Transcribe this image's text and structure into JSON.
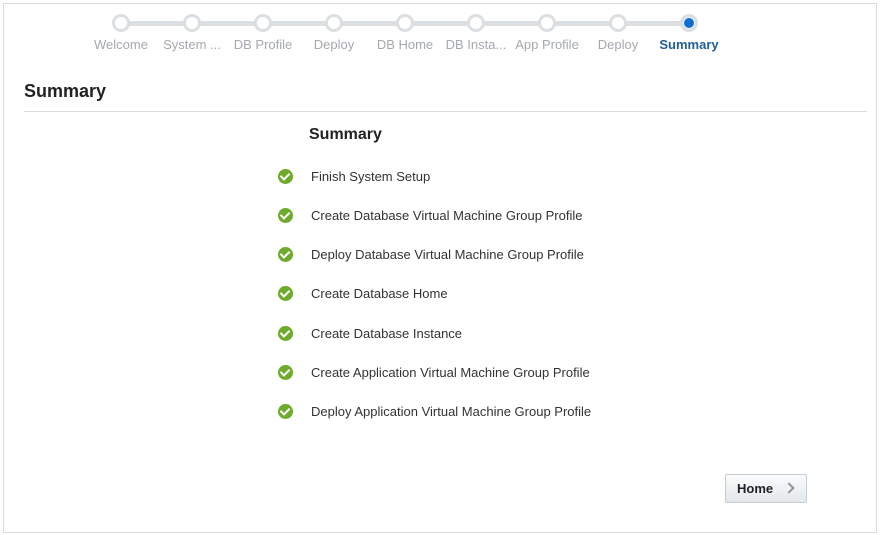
{
  "train": {
    "stops": [
      {
        "label": "Welcome",
        "current": false
      },
      {
        "label": "System ...",
        "current": false
      },
      {
        "label": "DB Profile",
        "current": false
      },
      {
        "label": "Deploy",
        "current": false
      },
      {
        "label": "DB Home",
        "current": false
      },
      {
        "label": "DB Insta...",
        "current": false
      },
      {
        "label": "App Profile",
        "current": false
      },
      {
        "label": "Deploy",
        "current": false
      },
      {
        "label": "Summary",
        "current": true
      }
    ]
  },
  "page_title": "Summary",
  "summary": {
    "heading": "Summary",
    "tasks": [
      {
        "label": "Finish System Setup",
        "status_icon": "check-circle-icon"
      },
      {
        "label": "Create Database Virtual Machine Group Profile",
        "status_icon": "check-circle-icon"
      },
      {
        "label": "Deploy Database Virtual Machine Group Profile",
        "status_icon": "check-circle-icon"
      },
      {
        "label": "Create Database Home",
        "status_icon": "check-circle-icon"
      },
      {
        "label": "Create Database Instance",
        "status_icon": "check-circle-icon"
      },
      {
        "label": "Create Application Virtual Machine Group Profile",
        "status_icon": "check-circle-icon"
      },
      {
        "label": "Deploy Application Virtual Machine Group Profile",
        "status_icon": "check-circle-icon"
      }
    ]
  },
  "footer": {
    "home_label": "Home",
    "home_icon": "chevron-right-icon"
  },
  "colors": {
    "accent": "#0e6ed0",
    "current_label": "#1f5e97",
    "success": "#6fab2b",
    "inactive": "#a5a9ad"
  }
}
